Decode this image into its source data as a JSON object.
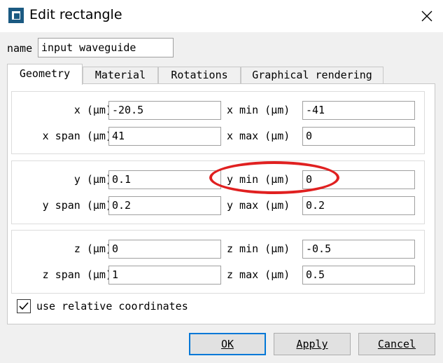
{
  "window": {
    "title": "Edit rectangle",
    "app_icon": "app-logo-icon",
    "close_icon": "close-icon"
  },
  "name": {
    "label": "name",
    "value": "input waveguide"
  },
  "tabs": [
    {
      "label": "Geometry",
      "active": true
    },
    {
      "label": "Material",
      "active": false
    },
    {
      "label": "Rotations",
      "active": false
    },
    {
      "label": "Graphical rendering",
      "active": false
    }
  ],
  "geometry": {
    "x": {
      "label": "x (μm)",
      "value": "-20.5"
    },
    "x_span": {
      "label": "x span (μm)",
      "value": "41"
    },
    "x_min": {
      "label": "x min (μm)",
      "value": "-41"
    },
    "x_max": {
      "label": "x max (μm)",
      "value": "0"
    },
    "y": {
      "label": "y (μm)",
      "value": "0.1"
    },
    "y_span": {
      "label": "y span (μm)",
      "value": "0.2"
    },
    "y_min": {
      "label": "y min (μm)",
      "value": "0"
    },
    "y_max": {
      "label": "y max (μm)",
      "value": "0.2"
    },
    "z": {
      "label": "z (μm)",
      "value": "0"
    },
    "z_span": {
      "label": "z span (μm)",
      "value": "1"
    },
    "z_min": {
      "label": "z min (μm)",
      "value": "-0.5"
    },
    "z_max": {
      "label": "z max (μm)",
      "value": "0.5"
    },
    "use_relative": {
      "label": "use relative coordinates",
      "checked": true
    }
  },
  "buttons": {
    "ok": "OK",
    "apply": "Apply",
    "cancel": "Cancel"
  },
  "colors": {
    "annotation": "#e02020",
    "default_button_border": "#0078d7",
    "icon": "#1b5a82"
  }
}
